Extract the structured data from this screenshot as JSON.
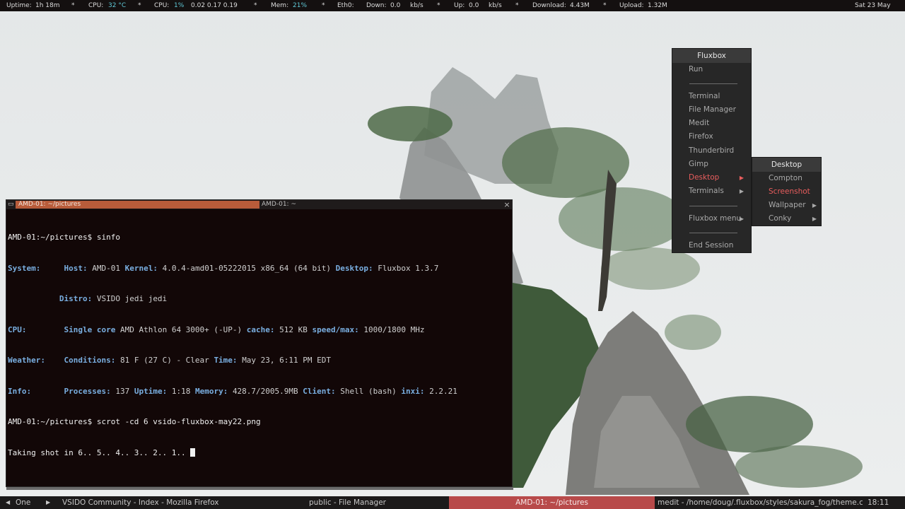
{
  "topbar": {
    "uptime_label": "Uptime:",
    "uptime_value": "1h 18m",
    "sep": "*",
    "cpu_temp_label": "CPU:",
    "cpu_temp_value": "32 °C",
    "cpu_label": "CPU:",
    "cpu_percent": "1%",
    "cpu_load": "0.02  0.17  0.19",
    "mem_label": "Mem:",
    "mem_percent": "21%",
    "eth_label": "Eth0:",
    "down_label": "Down:",
    "down_value": "0.0",
    "down_unit": "kb/s",
    "up_label": "Up:",
    "up_value": "0.0",
    "up_unit": "kb/s",
    "download_label": "Download:",
    "download_value": "4.43M",
    "upload_label": "Upload:",
    "upload_value": "1.32M",
    "date": "Sat 23  May"
  },
  "terminal": {
    "tab_active": "AMD-01: ~/pictures",
    "tab_inactive": "AMD-01: ~",
    "min_icon": "▭",
    "close_icon": "×",
    "prompt1": "AMD-01:~/pictures$ sinfo",
    "l_system": "System:",
    "l_host": "Host:",
    "v_host": "AMD-01",
    "l_kernel": "Kernel:",
    "v_kernel": "4.0.4-amd01-05222015 x86_64 (64 bit)",
    "l_desktop": "Desktop:",
    "v_desktop": "Fluxbox 1.3.7",
    "l_distro": "Distro:",
    "v_distro": "VSIDO jedi jedi",
    "l_cpu": "CPU:",
    "l_single": "Single core",
    "v_cpu": "AMD Athlon 64 3000+ (-UP-)",
    "l_cache": "cache:",
    "v_cache": "512 KB",
    "l_speed": "speed/max:",
    "v_speed": "1000/1800 MHz",
    "l_weather": "Weather:",
    "l_conditions": "Conditions:",
    "v_conditions": "81 F (27 C) - Clear",
    "l_time": "Time:",
    "v_time": "May 23, 6:11 PM EDT",
    "l_info": "Info:",
    "l_processes": "Processes:",
    "v_processes": "137",
    "l_uptime": "Uptime:",
    "v_uptime": "1:18",
    "l_memory": "Memory:",
    "v_memory": "428.7/2005.9MB",
    "l_client": "Client:",
    "v_client": "Shell (bash)",
    "l_inxi": "inxi:",
    "v_inxi": "2.2.21",
    "prompt2": "AMD-01:~/pictures$ scrot -cd 6 vsido-fluxbox-may22.png",
    "countdown": "Taking shot in 6.. 5.. 4.. 3.. 2.. 1.. "
  },
  "menu": {
    "title": "Fluxbox",
    "run": "Run",
    "terminal": "Terminal",
    "file_manager": "File Manager",
    "medit": "Medit",
    "firefox": "Firefox",
    "thunderbird": "Thunderbird",
    "gimp": "Gimp",
    "desktop": "Desktop",
    "terminals": "Terminals",
    "fluxbox_menu": "Fluxbox menu",
    "end_session": "End Session",
    "arrow": "▶"
  },
  "submenu": {
    "title": "Desktop",
    "compton": "Compton",
    "screenshot": "Screenshot",
    "wallpaper": "Wallpaper",
    "conky": "Conky"
  },
  "toolbar": {
    "workspace": "One",
    "task1": "VSIDO Community - Index - Mozilla Firefox",
    "task2": "public - File Manager",
    "task3": "AMD-01: ~/pictures",
    "task4": "medit - /home/doug/.fluxbox/styles/sakura_fog/theme.cfg",
    "clock": "18:11"
  },
  "colors": {
    "accent": "#b85c3a",
    "menu_active": "#e85d5d",
    "terminal_bg": "#120707",
    "terminal_label": "#79aee0"
  }
}
